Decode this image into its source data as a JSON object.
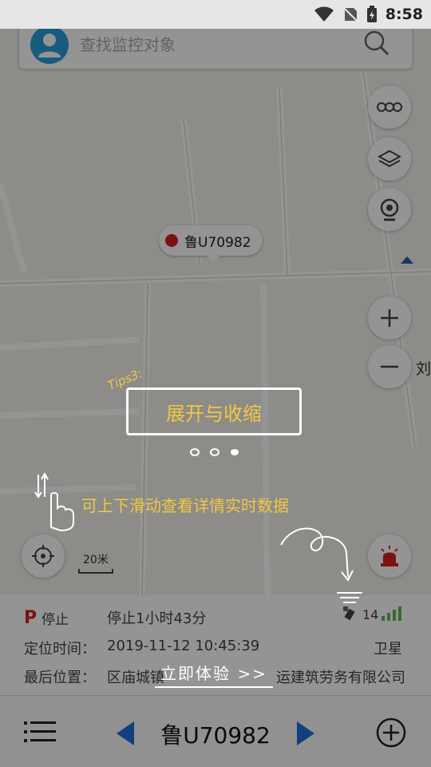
{
  "status_bar": {
    "time": "8:58"
  },
  "search": {
    "placeholder": "查找监控对象"
  },
  "map": {
    "vehicle_plate": "鲁U70982",
    "road_label": "刘",
    "scale": "20米"
  },
  "controls": {
    "traffic": "traffic-toggle",
    "layers": "layer-switch",
    "camera": "camera",
    "zoom_in": "+",
    "zoom_out": "−"
  },
  "info": {
    "status_label": "停止",
    "duration": "停止1小时43分",
    "signal_count": "14",
    "locate_time_label": "定位时间：",
    "locate_time": "2019-11-12 10:45:39",
    "locate_type": "卫星",
    "last_pos_label": "最后位置：",
    "last_pos": "区庙城镇",
    "last_pos_tail": "运建筑劳务有限公司"
  },
  "bottom_bar": {
    "plate": "鲁U70982"
  },
  "tips": {
    "tag": "Tips3:",
    "title": "展开与收缩",
    "subtitle": "可上下滑动查看详情实时数据",
    "action": "立即体验 >>"
  },
  "colors": {
    "accent": "#1e6fd6",
    "alert": "#d62020",
    "tip_yellow": "#f0c843",
    "avatar": "#2b9ddb"
  }
}
